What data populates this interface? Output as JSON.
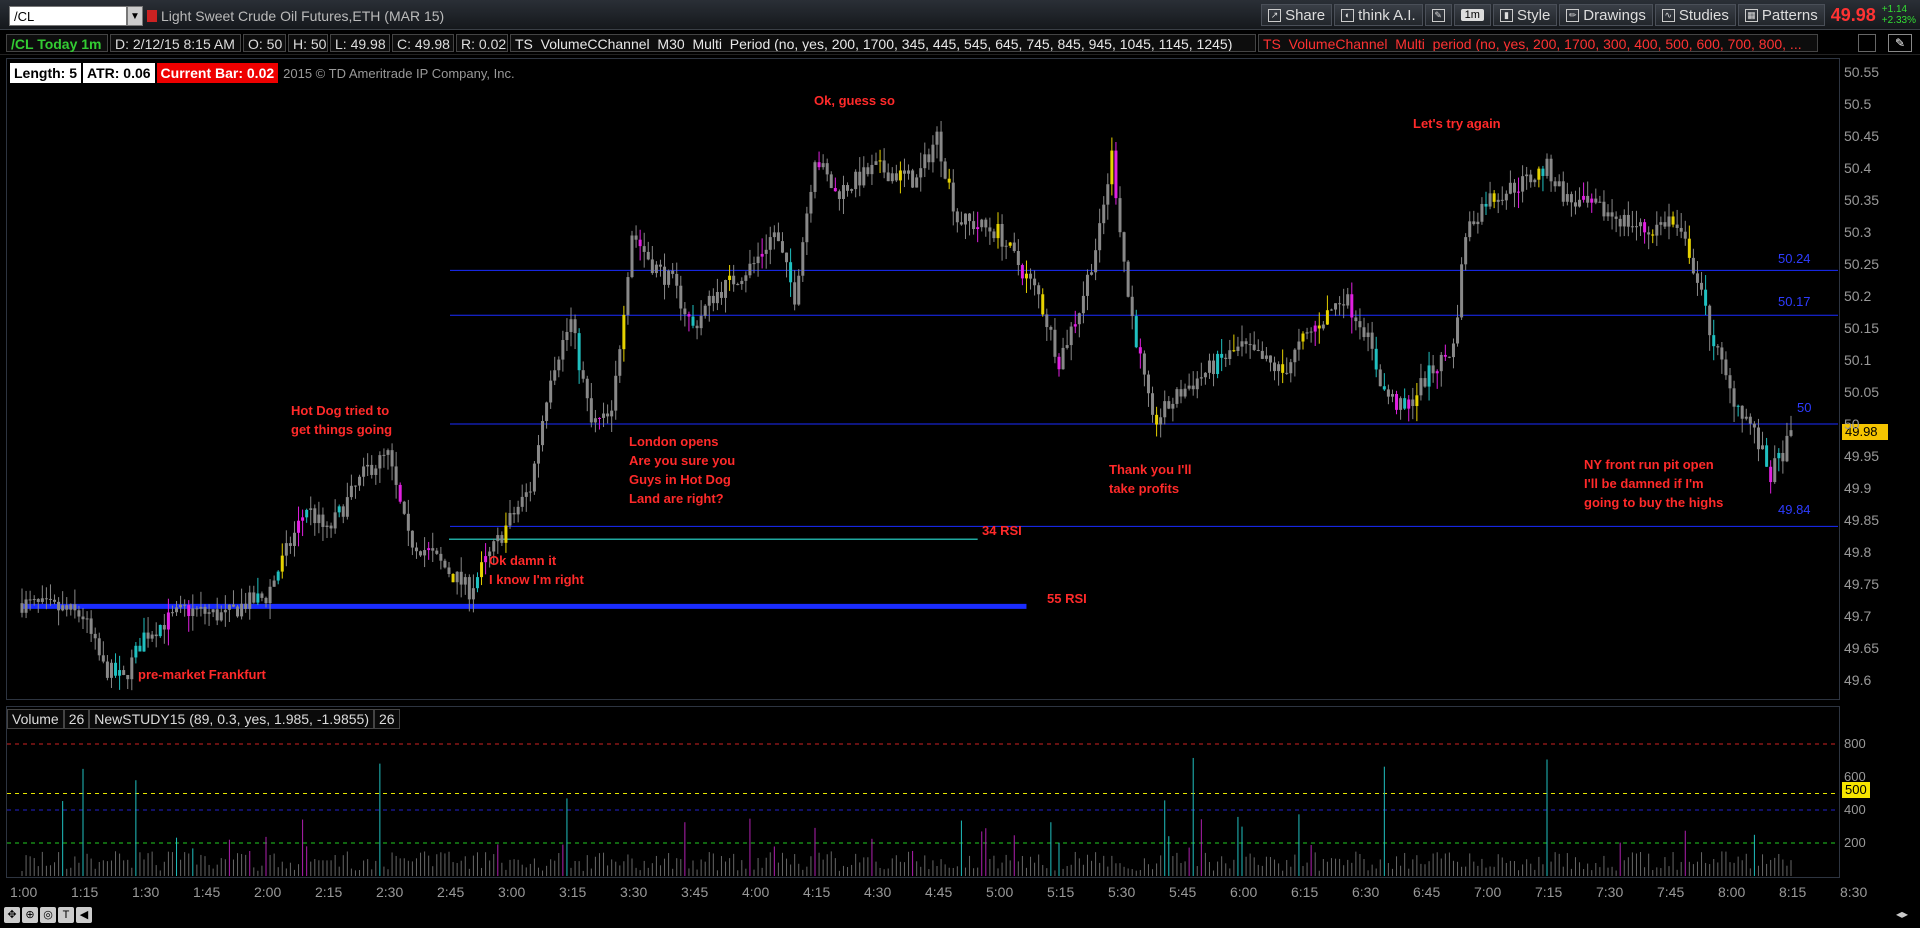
{
  "toolbar": {
    "symbol": "/CL",
    "description": "Light Sweet Crude Oil Futures,ETH (MAR 15)",
    "share_label": "Share",
    "think_label": "think A.I.",
    "timeframe_tag": "1m",
    "style_label": "Style",
    "drawings_label": "Drawings",
    "studies_label": "Studies",
    "patterns_label": "Patterns",
    "last_price": "49.98",
    "change": "+1.14",
    "change_pct": "+2.33%"
  },
  "infobar": {
    "title": "/CL Today 1m",
    "date": "D: 2/12/15 8:15 AM",
    "open": "O: 50",
    "high": "H: 50",
    "low": "L: 49.98",
    "close": "C: 49.98",
    "range": "R: 0.02",
    "study1": "TS_VolumeCChannel_M30_Multi_Period (no, yes, 200, 1700, 345, 445, 545, 645, 745, 845, 945, 1045, 1145, 1245)",
    "study2": "TS_VolumeChannel_Multi_period (no, yes, 200, 1700, 300, 400, 500, 600, 700, 800, ..."
  },
  "badges": {
    "length": "Length: 5",
    "atr": "ATR: 0.06",
    "current_bar": "Current Bar: 0.02",
    "copyright": "2015 © TD Ameritrade IP Company, Inc."
  },
  "annotations": {
    "premarket": "pre-market Frankfurt",
    "hotdog_1": "Hot Dog tried to",
    "hotdog_2": "get things going",
    "okdamn_1": "Ok damn it",
    "okdamn_2": "I know I'm right",
    "london_1": "London opens",
    "london_2": "Are you sure you",
    "london_3": "Guys in Hot Dog",
    "london_4": "Land are right?",
    "okguess": "Ok, guess so",
    "thankyou_1": "Thank you I'll",
    "thankyou_2": "take profits",
    "tryagain": "Let's try again",
    "ny_1": "NY front run pit open",
    "ny_2": "I'll be damned if I'm",
    "ny_3": "going to buy the highs",
    "rsi34": "34 RSI",
    "rsi55": "55 RSI"
  },
  "level_labels": {
    "l5024": "50.24",
    "l5017": "50.17",
    "l50": "50",
    "l4984": "49.84"
  },
  "price_axis": [
    "50.55",
    "50.5",
    "50.45",
    "50.4",
    "50.35",
    "50.3",
    "50.25",
    "50.2",
    "50.15",
    "50.1",
    "50.05",
    "50",
    "49.95",
    "49.9",
    "49.85",
    "49.8",
    "49.75",
    "49.7",
    "49.65",
    "49.6"
  ],
  "current_price_tag": "49.98",
  "lower_pane": {
    "study_a": "Volume",
    "study_a_len": "26",
    "study_b": "NewSTUDY15 (89, 0.3, yes, 1.985, -1.9855)",
    "study_b_len": "26",
    "axis": [
      "800",
      "600",
      "400",
      "200"
    ],
    "tag_500": "500"
  },
  "time_axis": [
    "1:00",
    "1:15",
    "1:30",
    "1:45",
    "2:00",
    "2:15",
    "2:30",
    "2:45",
    "3:00",
    "3:15",
    "3:30",
    "3:45",
    "4:00",
    "4:15",
    "4:30",
    "4:45",
    "5:00",
    "5:15",
    "5:30",
    "5:45",
    "6:00",
    "6:15",
    "6:30",
    "6:45",
    "7:00",
    "7:15",
    "7:30",
    "7:45",
    "8:00",
    "8:15",
    "8:30"
  ],
  "colors": {
    "annotation_red": "#ff2a2a",
    "level_blue": "#1a2cff",
    "study_red": "#ff3333",
    "green_title": "#33cc33",
    "magenta": "#e020e0",
    "cyan": "#20c0c0"
  },
  "chart_data": {
    "type": "candlestick",
    "symbol": "/CL",
    "ylim": [
      49.6,
      50.55
    ],
    "price_path": [
      [
        "1:00",
        49.72
      ],
      [
        "1:10",
        49.71
      ],
      [
        "1:15",
        49.7
      ],
      [
        "1:20",
        49.62
      ],
      [
        "1:25",
        49.6
      ],
      [
        "1:30",
        49.67
      ],
      [
        "1:40",
        49.71
      ],
      [
        "1:50",
        49.7
      ],
      [
        "1:55",
        49.72
      ],
      [
        "2:00",
        49.73
      ],
      [
        "2:10",
        49.87
      ],
      [
        "2:15",
        49.83
      ],
      [
        "2:25",
        49.93
      ],
      [
        "2:30",
        49.95
      ],
      [
        "2:35",
        49.82
      ],
      [
        "2:40",
        49.8
      ],
      [
        "2:45",
        49.77
      ],
      [
        "2:50",
        49.74
      ],
      [
        "3:00",
        49.85
      ],
      [
        "3:05",
        49.9
      ],
      [
        "3:10",
        50.08
      ],
      [
        "3:15",
        50.16
      ],
      [
        "3:20",
        50.0
      ],
      [
        "3:25",
        50.01
      ],
      [
        "3:30",
        50.3
      ],
      [
        "3:35",
        50.25
      ],
      [
        "3:40",
        50.22
      ],
      [
        "3:45",
        50.15
      ],
      [
        "3:50",
        50.2
      ],
      [
        "4:00",
        50.25
      ],
      [
        "4:05",
        50.3
      ],
      [
        "4:10",
        50.2
      ],
      [
        "4:15",
        50.42
      ],
      [
        "4:20",
        50.36
      ],
      [
        "4:30",
        50.4
      ],
      [
        "4:40",
        50.38
      ],
      [
        "4:45",
        50.45
      ],
      [
        "4:50",
        50.32
      ],
      [
        "5:00",
        50.3
      ],
      [
        "5:10",
        50.2
      ],
      [
        "5:15",
        50.1
      ],
      [
        "5:20",
        50.18
      ],
      [
        "5:25",
        50.3
      ],
      [
        "5:28",
        50.42
      ],
      [
        "5:32",
        50.2
      ],
      [
        "5:38",
        50.0
      ],
      [
        "5:45",
        50.05
      ],
      [
        "5:55",
        50.1
      ],
      [
        "6:00",
        50.12
      ],
      [
        "6:10",
        50.08
      ],
      [
        "6:15",
        50.13
      ],
      [
        "6:25",
        50.2
      ],
      [
        "6:30",
        50.15
      ],
      [
        "6:35",
        50.05
      ],
      [
        "6:40",
        50.02
      ],
      [
        "6:45",
        50.07
      ],
      [
        "6:52",
        50.12
      ],
      [
        "6:55",
        50.3
      ],
      [
        "7:00",
        50.35
      ],
      [
        "7:10",
        50.38
      ],
      [
        "7:15",
        50.4
      ],
      [
        "7:20",
        50.35
      ],
      [
        "7:30",
        50.33
      ],
      [
        "7:40",
        50.3
      ],
      [
        "7:45",
        50.32
      ],
      [
        "7:50",
        50.27
      ],
      [
        "7:55",
        50.15
      ],
      [
        "8:00",
        50.05
      ],
      [
        "8:05",
        50.0
      ],
      [
        "8:10",
        49.92
      ],
      [
        "8:15",
        49.98
      ]
    ],
    "levels": [
      {
        "label": "50.24",
        "value": 50.24
      },
      {
        "label": "50.17",
        "value": 50.17
      },
      {
        "label": "50",
        "value": 50.0
      },
      {
        "label": "49.84",
        "value": 49.84
      }
    ],
    "rsi_levels": [
      {
        "label": "34 RSI",
        "value": 49.82,
        "start": "2:45",
        "end": "4:55"
      },
      {
        "label": "55 RSI",
        "value": 49.715,
        "start": "1:00",
        "end": "5:07"
      }
    ]
  }
}
